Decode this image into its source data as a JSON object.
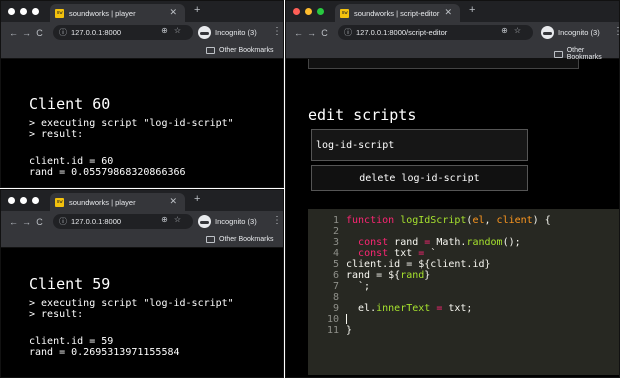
{
  "left_top": {
    "tab_title": "soundworks | player",
    "favicon_text": "sw",
    "url": "127.0.0.1:8000",
    "incognito": "Incognito (3)",
    "bookmark": "Other Bookmarks",
    "client_title": "Client 60",
    "lines": [
      "> executing script \"log-id-script\"",
      "> result:"
    ],
    "result": [
      "client.id = 60",
      "rand = 0.05579868320866366"
    ]
  },
  "left_bottom": {
    "tab_title": "soundworks | player",
    "favicon_text": "sw",
    "url": "127.0.0.1:8000",
    "incognito": "Incognito (3)",
    "bookmark": "Other Bookmarks",
    "client_title": "Client 59",
    "lines": [
      "> executing script \"log-id-script\"",
      "> result:"
    ],
    "result": [
      "client.id = 59",
      "rand = 0.2695313971155584"
    ]
  },
  "right": {
    "tab_title": "soundworks | script-editor",
    "favicon_text": "sw",
    "url": "127.0.0.1:8000/script-editor",
    "incognito": "Incognito (3)",
    "bookmark": "Other Bookmarks",
    "heading": "edit scripts",
    "script_name": "log-id-script",
    "delete_label": "delete log-id-script",
    "code_lines": [
      {
        "n": "1",
        "parts": [
          [
            "kw",
            "function "
          ],
          [
            "fn",
            "logIdScript"
          ],
          [
            "pl",
            "("
          ],
          [
            "pa",
            "el"
          ],
          [
            "pl",
            ", "
          ],
          [
            "pa",
            "client"
          ],
          [
            "pl",
            ") {"
          ]
        ]
      },
      {
        "n": "2",
        "parts": []
      },
      {
        "n": "3",
        "parts": [
          [
            "pl",
            "  "
          ],
          [
            "kw",
            "const "
          ],
          [
            "pl",
            "rand "
          ],
          [
            "kw",
            "= "
          ],
          [
            "pl",
            "Math."
          ],
          [
            "fn",
            "random"
          ],
          [
            "pl",
            "();"
          ]
        ]
      },
      {
        "n": "4",
        "parts": [
          [
            "pl",
            "  "
          ],
          [
            "kw",
            "const "
          ],
          [
            "pl",
            "txt "
          ],
          [
            "kw",
            "= "
          ],
          [
            "pl",
            "`"
          ]
        ]
      },
      {
        "n": "5",
        "parts": [
          [
            "pl",
            "client.id = ${"
          ],
          [
            "pl",
            "client.id"
          ],
          [
            "pl",
            "}"
          ]
        ]
      },
      {
        "n": "6",
        "parts": [
          [
            "pl",
            "rand = ${"
          ],
          [
            "fn",
            "rand"
          ],
          [
            "pl",
            "}"
          ]
        ]
      },
      {
        "n": "7",
        "parts": [
          [
            "pl",
            "  `;"
          ]
        ]
      },
      {
        "n": "8",
        "parts": []
      },
      {
        "n": "9",
        "parts": [
          [
            "pl",
            "  el."
          ],
          [
            "fn",
            "innerText"
          ],
          [
            "pl",
            " "
          ],
          [
            "kw",
            "= "
          ],
          [
            "pl",
            "txt;"
          ]
        ]
      },
      {
        "n": "10",
        "parts": [
          [
            "cursor",
            ""
          ]
        ]
      },
      {
        "n": "11",
        "parts": [
          [
            "pl",
            "}"
          ]
        ]
      }
    ]
  }
}
